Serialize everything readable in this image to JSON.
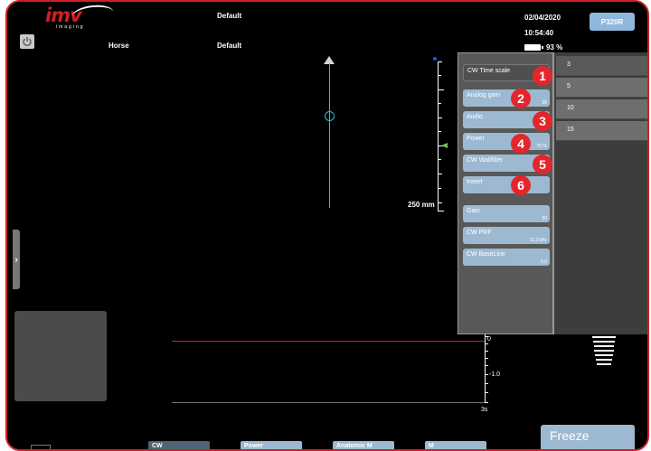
{
  "header": {
    "logo_main": "imv",
    "logo_sub": "imaging",
    "preset_top": "Default",
    "animal": "Horse",
    "preset_sub": "Default",
    "date": "02/04/2020",
    "time": "10:54:40",
    "battery": "93 %",
    "probe": "P320R"
  },
  "image": {
    "depth_label": "250 mm"
  },
  "panel": {
    "items": [
      {
        "label": "CW Time scale",
        "value": "",
        "badge": "1"
      },
      {
        "label": "Analog gain",
        "value": "35",
        "badge": "2"
      },
      {
        "label": "Audio",
        "value": "",
        "badge": "3"
      },
      {
        "label": "Power",
        "value": "70 %",
        "badge": "4"
      },
      {
        "label": "CW Wallfilter",
        "value": "",
        "badge": "5"
      },
      {
        "label": "Invert",
        "value": "",
        "badge": "6"
      },
      {
        "label": "Gain",
        "value": "50"
      },
      {
        "label": "CW PRF",
        "value": "11.3 kHz"
      },
      {
        "label": "CW BaseLine",
        "value": "0.0"
      }
    ],
    "options": [
      "3",
      "5",
      "10",
      "15"
    ]
  },
  "trace": {
    "axis_zero": "0",
    "axis_neg": "-1.0",
    "time_label": "3s"
  },
  "bottom": {
    "tabs": [
      "CW",
      "Power",
      "Anatomic M",
      "M"
    ],
    "freeze": "Freeze"
  },
  "colors": {
    "frame_red": "#d01f24",
    "button_blue": "#9db9d2",
    "scan_cyan": "#27c1d9",
    "badge_red": "#e4262b"
  }
}
